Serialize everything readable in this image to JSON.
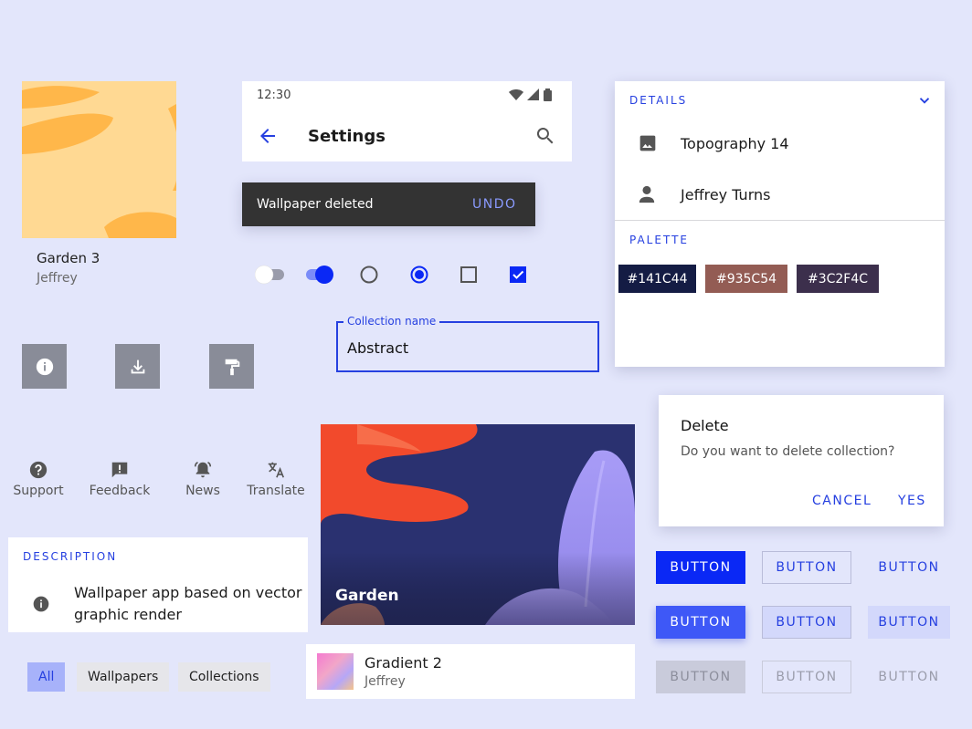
{
  "thumb_card": {
    "title": "Garden 3",
    "subtitle": "Jeffrey"
  },
  "appbar": {
    "time": "12:30",
    "title": "Settings"
  },
  "snackbar": {
    "message": "Wallpaper deleted",
    "action": "UNDO"
  },
  "text_field": {
    "label": "Collection name",
    "value": "Abstract"
  },
  "details": {
    "overline": "DETAILS",
    "items": [
      {
        "icon": "image-icon",
        "label": "Topography 14"
      },
      {
        "icon": "person-icon",
        "label": "Jeffrey Turns"
      }
    ],
    "palette_overline": "PALETTE",
    "swatches": [
      {
        "label": "#141C44",
        "color": "#141c44"
      },
      {
        "label": "#935C54",
        "color": "#935c54"
      },
      {
        "label": "#3C2F4C",
        "color": "#3c2f4c"
      }
    ]
  },
  "dialog": {
    "title": "Delete",
    "body": "Do you want to delete collection?",
    "cancel": "CANCEL",
    "confirm": "YES"
  },
  "labeled_icons": [
    {
      "icon": "help-icon",
      "label": "Support"
    },
    {
      "icon": "feedback-icon",
      "label": "Feedback"
    },
    {
      "icon": "notification-icon",
      "label": "News"
    },
    {
      "icon": "translate-icon",
      "label": "Translate"
    }
  ],
  "description": {
    "overline": "DESCRIPTION",
    "text_line1": "Wallpaper app based on vector",
    "text_line2": "graphic render"
  },
  "hero": {
    "title": "Garden"
  },
  "gradient_item": {
    "title": "Gradient 2",
    "subtitle": "Jeffrey"
  },
  "chips": [
    "All",
    "Wallpapers",
    "Collections"
  ],
  "buttons": {
    "label": "BUTTON"
  },
  "colors": {
    "primary": "#2640e0",
    "background": "#e3e6fb",
    "hero_bg": "#2a3170",
    "hero_accent": "#f24a2c"
  }
}
